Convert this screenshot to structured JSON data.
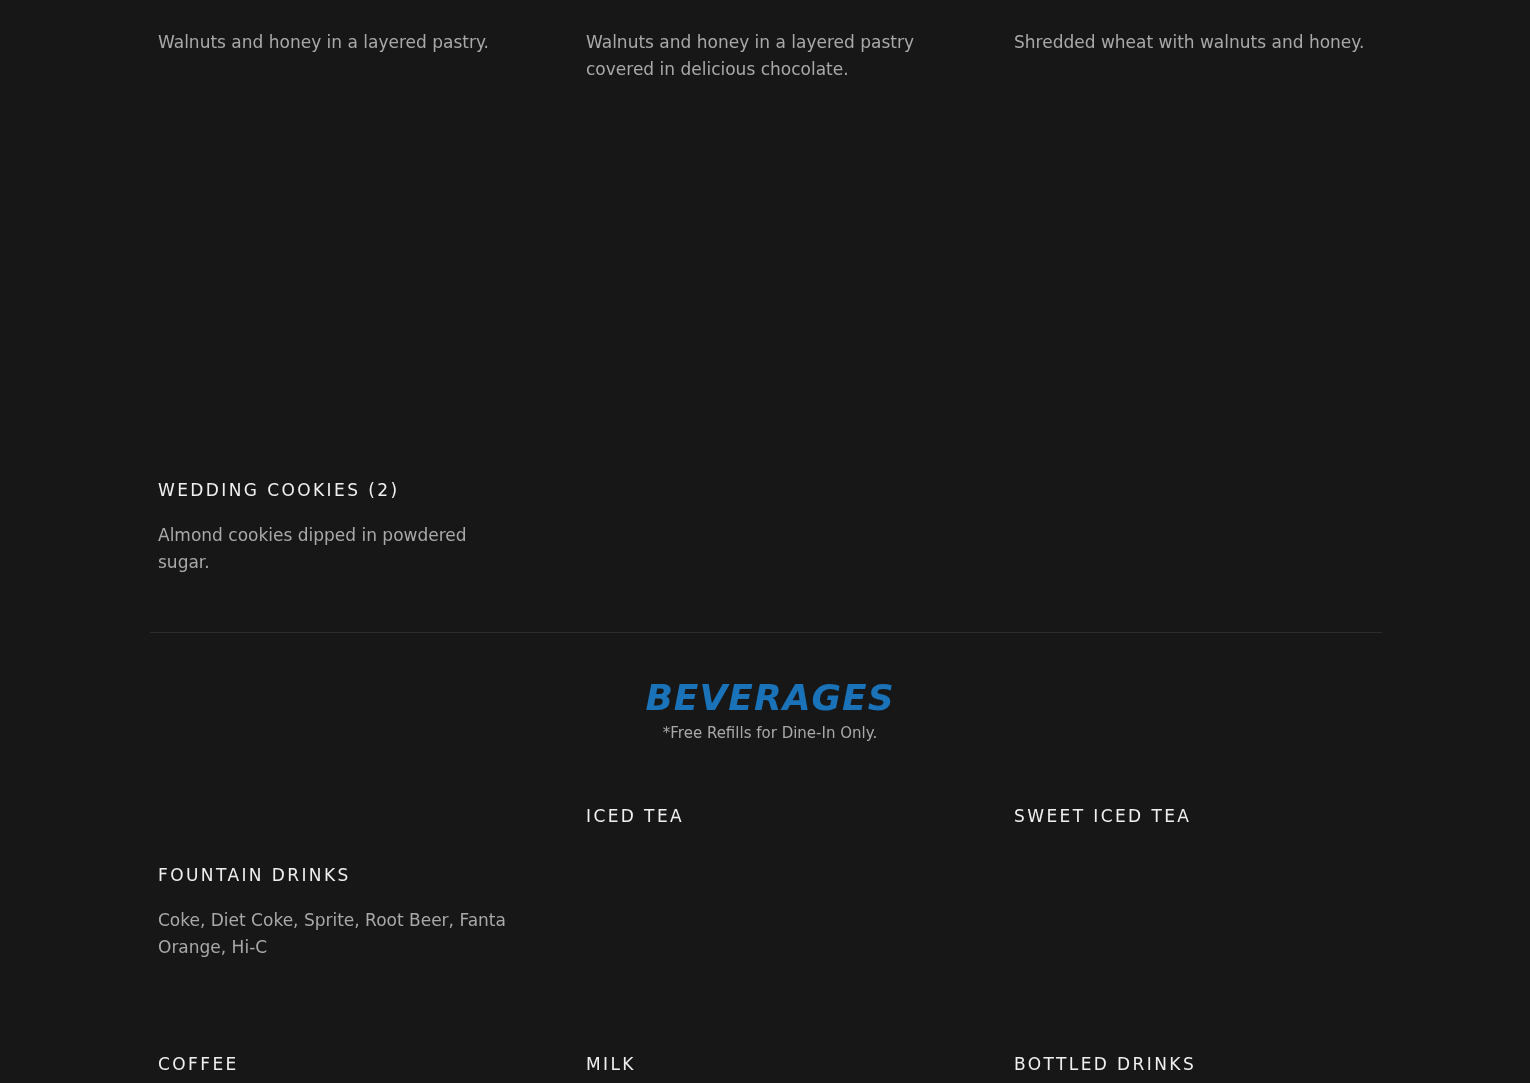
{
  "sections": [
    {
      "items": [
        {
          "description": "Walnuts and honey in a layered pastry."
        },
        {
          "description": "Walnuts and honey in a layered pastry covered in delicious chocolate."
        },
        {
          "description": "Shredded wheat with walnuts and honey."
        },
        {
          "name": "WEDDING COOKIES (2)",
          "description": "Almond cookies dipped in powdered sugar."
        }
      ]
    },
    {
      "title": "BEVERAGES",
      "note": "*Free Refills for Dine-In Only.",
      "items": [
        {
          "name": "FOUNTAIN DRINKS",
          "description": "Coke, Diet Coke, Sprite, Root Beer, Fanta Orange, Hi-C"
        },
        {
          "name": "ICED TEA"
        },
        {
          "name": "SWEET ICED TEA"
        },
        {
          "name": "COFFEE"
        },
        {
          "name": "MILK"
        },
        {
          "name": "BOTTLED DRINKS"
        }
      ]
    }
  ]
}
